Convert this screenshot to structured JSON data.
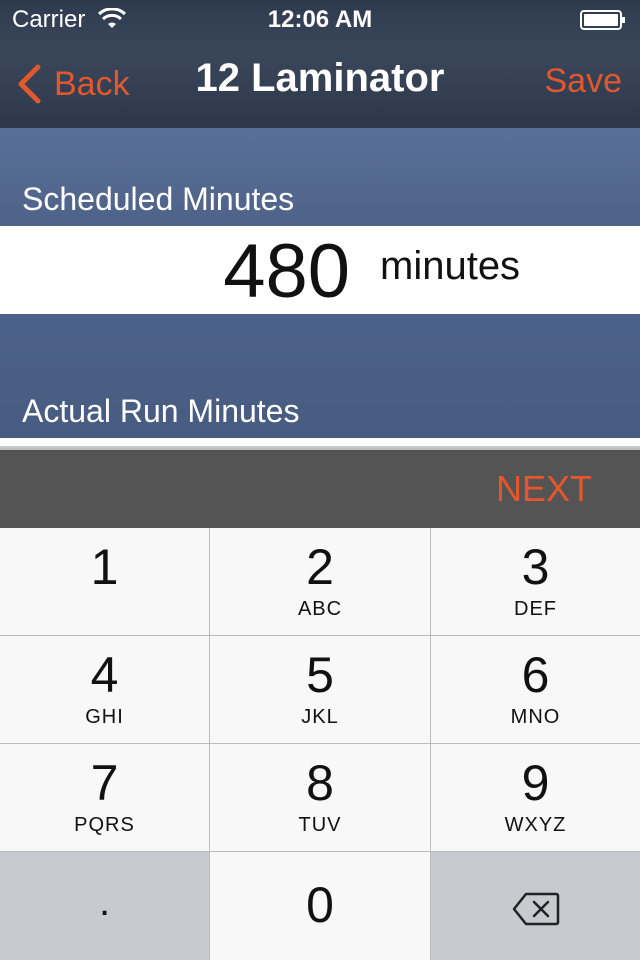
{
  "status_bar": {
    "carrier": "Carrier",
    "time": "12:06 AM"
  },
  "nav": {
    "back_label": "Back",
    "title": "12 Laminator",
    "save_label": "Save"
  },
  "form": {
    "scheduled_label": "Scheduled Minutes",
    "scheduled_value": "480",
    "unit": "minutes",
    "actual_label": "Actual Run Minutes"
  },
  "accessory": {
    "next_label": "NEXT"
  },
  "keypad": {
    "keys": [
      {
        "digit": "1",
        "letters": ""
      },
      {
        "digit": "2",
        "letters": "ABC"
      },
      {
        "digit": "3",
        "letters": "DEF"
      },
      {
        "digit": "4",
        "letters": "GHI"
      },
      {
        "digit": "5",
        "letters": "JKL"
      },
      {
        "digit": "6",
        "letters": "MNO"
      },
      {
        "digit": "7",
        "letters": "PQRS"
      },
      {
        "digit": "8",
        "letters": "TUV"
      },
      {
        "digit": "9",
        "letters": "WXYZ"
      },
      {
        "digit": "0",
        "letters": ""
      }
    ],
    "dot_label": ".",
    "delete_icon": "backspace-icon"
  },
  "colors": {
    "accent": "#e1582e",
    "header_bg": "#2e3a4e",
    "section_bg": "#5a6f98",
    "toolbar_bg": "#545454"
  }
}
